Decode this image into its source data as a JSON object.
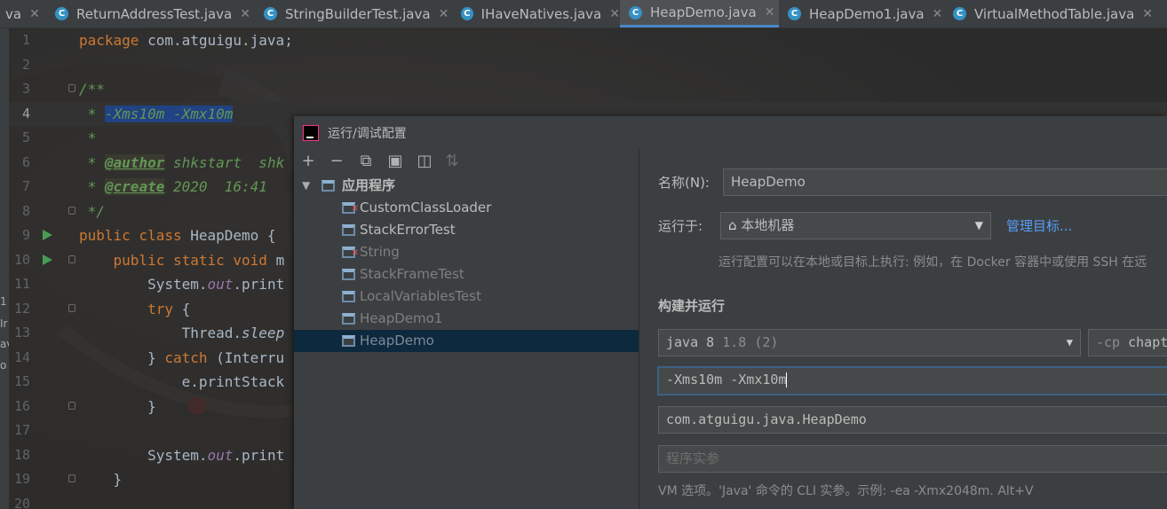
{
  "tabs": [
    {
      "label": "va",
      "has_icon": false,
      "active": false
    },
    {
      "label": "ReturnAddressTest.java",
      "has_icon": true,
      "active": false
    },
    {
      "label": "StringBuilderTest.java",
      "has_icon": true,
      "active": false
    },
    {
      "label": "IHaveNatives.java",
      "has_icon": true,
      "active": false
    },
    {
      "label": "HeapDemo.java",
      "has_icon": true,
      "active": true
    },
    {
      "label": "HeapDemo1.java",
      "has_icon": true,
      "active": false
    },
    {
      "label": "VirtualMethodTable.java",
      "has_icon": true,
      "active": false
    }
  ],
  "left_strip": [
    "1",
    "Ir",
    "av",
    "o"
  ],
  "editor": {
    "current_line": 4,
    "lines": [
      {
        "n": "1",
        "t": [
          [
            "kw",
            "package "
          ],
          [
            "",
            "com.atguigu.java;"
          ]
        ]
      },
      {
        "n": "2",
        "t": []
      },
      {
        "n": "3",
        "t": [
          [
            "cm",
            "/**"
          ]
        ],
        "fold": true
      },
      {
        "n": "4",
        "t": [
          [
            "cm",
            " * "
          ],
          [
            "cmsel",
            "-Xms10m -Xmx10m"
          ]
        ]
      },
      {
        "n": "5",
        "t": [
          [
            "cm",
            " *"
          ]
        ]
      },
      {
        "n": "6",
        "t": [
          [
            "cm",
            " * "
          ],
          [
            "tag",
            "@author"
          ],
          [
            "cm",
            " shkstart  shk"
          ]
        ]
      },
      {
        "n": "7",
        "t": [
          [
            "cm",
            " * "
          ],
          [
            "tag",
            "@create"
          ],
          [
            "cm",
            " 2020  16:41"
          ]
        ]
      },
      {
        "n": "8",
        "t": [
          [
            "cm",
            " */"
          ]
        ],
        "fold": true
      },
      {
        "n": "9",
        "t": [
          [
            "kw",
            "public class "
          ],
          [
            "",
            "HeapDemo {"
          ]
        ],
        "run": true
      },
      {
        "n": "10",
        "t": [
          [
            "",
            "    "
          ],
          [
            "kw",
            "public static void "
          ],
          [
            "",
            "m"
          ]
        ],
        "run": true,
        "fold": true
      },
      {
        "n": "11",
        "t": [
          [
            "",
            "        System."
          ],
          [
            "fld",
            "out"
          ],
          [
            "",
            ".print"
          ]
        ]
      },
      {
        "n": "12",
        "t": [
          [
            "",
            "        "
          ],
          [
            "kw",
            "try "
          ],
          [
            "",
            "{"
          ]
        ],
        "fold": true
      },
      {
        "n": "13",
        "t": [
          [
            "",
            "            Thread."
          ],
          [
            "mth",
            "sleep"
          ]
        ]
      },
      {
        "n": "14",
        "t": [
          [
            "",
            "        } "
          ],
          [
            "kw",
            "catch "
          ],
          [
            "",
            "(Interru"
          ]
        ]
      },
      {
        "n": "15",
        "t": [
          [
            "",
            "            e.printStack"
          ]
        ]
      },
      {
        "n": "16",
        "t": [
          [
            "",
            "        }"
          ]
        ],
        "fold": true
      },
      {
        "n": "17",
        "t": []
      },
      {
        "n": "18",
        "t": [
          [
            "",
            "        System."
          ],
          [
            "fld",
            "out"
          ],
          [
            "",
            ".print"
          ]
        ]
      },
      {
        "n": "19",
        "t": [
          [
            "",
            "    }"
          ]
        ],
        "fold": true
      },
      {
        "n": "20",
        "t": []
      }
    ]
  },
  "dialog": {
    "title": "运行/调试配置",
    "toolbar": [
      "+",
      "−",
      "⧉",
      "▣",
      "◫",
      "⇅"
    ],
    "tree": {
      "root": "应用程序",
      "items": [
        {
          "label": "CustomClassLoader",
          "style": "norm",
          "error": true
        },
        {
          "label": "StackErrorTest",
          "style": "norm",
          "error": false
        },
        {
          "label": "String",
          "style": "dim",
          "error": true
        },
        {
          "label": "StackFrameTest",
          "style": "dim",
          "error": false
        },
        {
          "label": "LocalVariablesTest",
          "style": "dim",
          "error": false
        },
        {
          "label": "HeapDemo1",
          "style": "dim",
          "error": false
        },
        {
          "label": "HeapDemo",
          "style": "selcol",
          "error": false,
          "selected": true
        }
      ]
    },
    "form": {
      "name_label": "名称(N):",
      "name_value": "HeapDemo",
      "run_on_label": "运行于:",
      "run_on_value": "本地机器",
      "manage_targets": "管理目标...",
      "run_on_hint": "运行配置可以在本地或目标上执行: 例如，在 Docker 容器中或使用 SSH 在远",
      "section_title": "构建并运行",
      "jre_value_main": "java 8",
      "jre_value_detail": "1.8 (2)",
      "cp_placeholder": "-cp",
      "cp_value": "chapt",
      "vm_options": "-Xms10m -Xmx10m",
      "main_class": "com.atguigu.java.HeapDemo",
      "program_args_placeholder": "程序实参",
      "vm_hint": "VM 选项。'Java' 命令的 CLI 实参。示例: -ea -Xmx2048m. Alt+V"
    }
  }
}
